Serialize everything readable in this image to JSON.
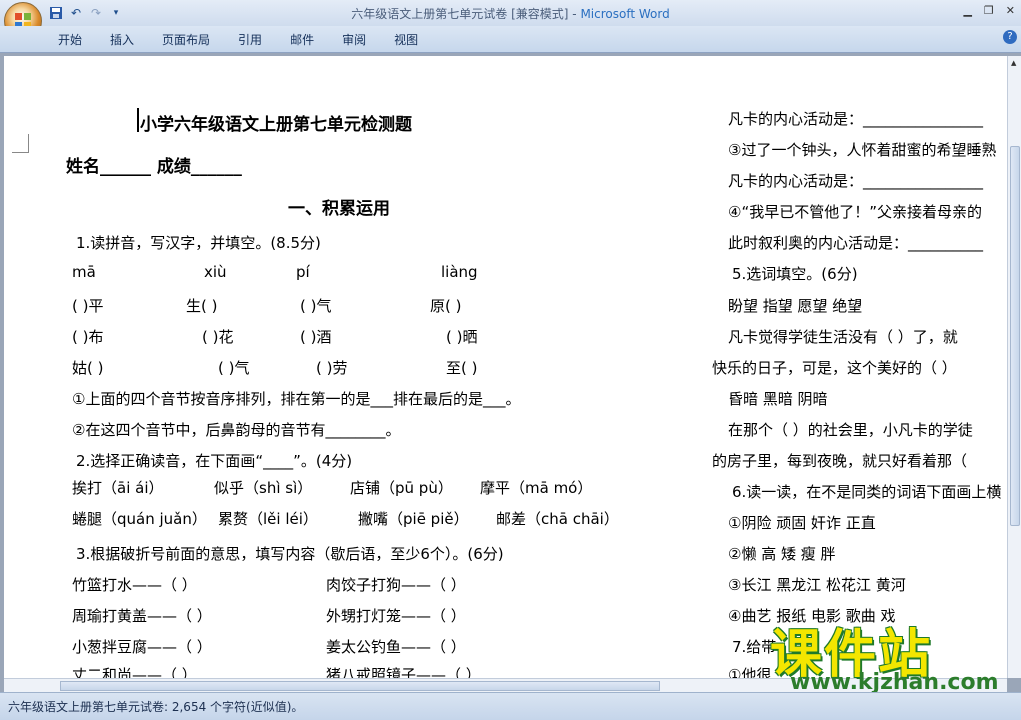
{
  "titlebar": {
    "doc_title": "六年级语文上册第七单元试卷 [兼容模式]",
    "app_name": "Microsoft Word",
    "separator": " - "
  },
  "qat": {
    "save_icon": "save-icon",
    "undo_icon": "undo-icon",
    "redo_icon": "redo-icon",
    "customize_icon": "chevron-down-icon"
  },
  "ribbon": {
    "tabs": [
      "开始",
      "插入",
      "页面布局",
      "引用",
      "邮件",
      "审阅",
      "视图"
    ],
    "help": "?"
  },
  "doc": {
    "title": "小学六年级语文上册第七单元检测题",
    "name_line": "姓名______   成绩______",
    "section1": "一、积累运用",
    "q1": "1.读拼音，写汉字，并填空。(8.5分)",
    "pinyin": [
      "mā",
      "xiù",
      "pí",
      "liàng"
    ],
    "row1": [
      "(    )平",
      "生(    )",
      "(    )气",
      "原(    )"
    ],
    "row2": [
      "(    )布",
      "(    )花",
      "(    )酒",
      "(    )晒"
    ],
    "row3": [
      "姑(    )",
      "(    )气",
      "(    )劳",
      "至(    )"
    ],
    "q1a": "①上面的四个音节按音序排列，排在第一的是___排在最后的是___。",
    "q1b": "②在这四个音节中，后鼻韵母的音节有________。",
    "q2": "2.选择正确读音，在下面画“____”。(4分)",
    "q2r1": [
      "挨打（āi  ái）",
      "似乎（shì  sì）",
      "店铺（pū  pù）",
      "摩平（mā  mó）"
    ],
    "q2r2": [
      "蜷腿（quán  juǎn）",
      "累赘（lěi  léi）",
      "撇嘴（piē  piě）",
      "邮差（chā  chāi）"
    ],
    "q3": "3.根据破折号前面的意思，填写内容（歇后语，至少6个）。(6分)",
    "q3l": [
      "竹篮打水——（          ）",
      "周瑜打黄盖——（          ）",
      "小葱拌豆腐——（          ）",
      "丈二和尚——（          ）"
    ],
    "q3r": [
      "肉饺子打狗——（          ）",
      "外甥打灯笼——（          ）",
      "姜太公钓鱼——（          ）",
      "猪八戒照镜子——（          ）"
    ],
    "right": [
      "凡卡的内心活动是：________________",
      "③过了一个钟头，人怀着甜蜜的希望睡熟",
      "凡卡的内心活动是：________________",
      "④“我早已不管他了！”父亲接着母亲的",
      "此时叙利奥的内心活动是：__________",
      "5.选词填空。(6分)",
      "盼望        指望        愿望        绝望",
      "凡卡觉得学徒生活没有（        ）了，就",
      "快乐的日子，可是，这个美好的（        ）",
      "昏暗        黑暗        阴暗",
      "在那个（        ）的社会里，小凡卡的学徒",
      "的房子里，每到夜晚，就只好看着那（",
      "6.读一读，在不是同类的词语下面画上横",
      "①阴险    顽固    奸诈      正直",
      "②懒      高      矮      瘦      胖",
      "③长江      黑龙江      松花江      黄河",
      "④曲艺      报纸      电影      歌曲      戏",
      "7.给带",
      "①他很"
    ]
  },
  "status": {
    "text": "六年级语文上册第七单元试卷: 2,654 个字符(近似值)。"
  },
  "watermark": {
    "text": "课件站",
    "url": "www.kjzhan.com"
  }
}
